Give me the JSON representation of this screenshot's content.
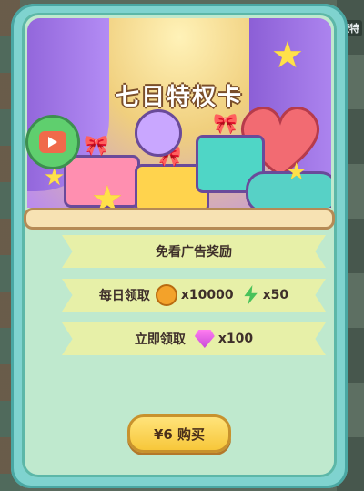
{
  "backdrop_tag": "亚特",
  "card": {
    "title": "七日特权卡",
    "rows": [
      {
        "label": "免看广告奖励"
      },
      {
        "label": "每日领取",
        "items": [
          {
            "icon": "gold-coin-icon",
            "amount": "x10000"
          },
          {
            "icon": "green-energy-bolt-icon",
            "amount": "x50"
          }
        ]
      },
      {
        "label": "立即领取",
        "items": [
          {
            "icon": "pink-gem-icon",
            "amount": "x100"
          }
        ]
      }
    ],
    "buy_button_label": "¥6 购买"
  },
  "colors": {
    "frame": "#7fd3cf",
    "inner_bg": "#bfe9ce",
    "row_bg": "#e7f0a8",
    "button": "#f7c73a",
    "title_outline": "#7a4e2a"
  }
}
